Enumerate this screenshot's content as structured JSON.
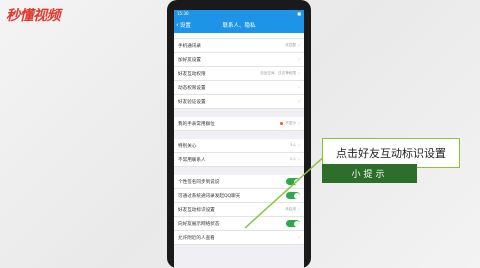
{
  "watermark": "秒懂视频",
  "status": {
    "time": "15:30",
    "battery": "■"
  },
  "header": {
    "back_label": "设置",
    "title": "联系人、隐私"
  },
  "rows": [
    {
      "label": "",
      "value": "",
      "type": "partial"
    },
    {
      "label": "手机通讯录",
      "value": "未匹配",
      "type": "value"
    },
    {
      "label": "加好友设置",
      "value": "",
      "type": "arrow"
    },
    {
      "label": "好友互动权限",
      "value": "包含空间、日志等权限",
      "type": "value"
    },
    {
      "label": "动态权限设置",
      "value": "",
      "type": "arrow"
    },
    {
      "label": "好友验证设置",
      "value": "",
      "type": "arrow"
    },
    {
      "label": "",
      "value": "",
      "type": "gap"
    },
    {
      "label": "我的手表常用群位",
      "value": "不显示",
      "type": "dot"
    },
    {
      "label": "",
      "value": "",
      "type": "gap"
    },
    {
      "label": "特别关心",
      "value": "5人",
      "type": "value"
    },
    {
      "label": "不常用联系人",
      "value": "0人",
      "type": "value"
    },
    {
      "label": "",
      "value": "",
      "type": "gap"
    },
    {
      "label": "个性签名同步到说说",
      "value": "",
      "type": "toggle"
    },
    {
      "label": "可通过系统通讯录发起QQ聊天",
      "value": "",
      "type": "toggle"
    },
    {
      "label": "好友互动标识设置",
      "value": "未启用",
      "type": "value"
    },
    {
      "label": "向好友展示网络状态",
      "value": "",
      "type": "toggle"
    },
    {
      "label": "允许附近的人查看",
      "value": "",
      "type": "arrow"
    }
  ],
  "callout": {
    "text": "点击好友互动标识设置",
    "tip": "小提示"
  },
  "colors": {
    "header": "#1e94e8",
    "toggle": "#2ea94a",
    "callout_border": "#8fbf3a",
    "tip_bg": "#2c6e2a"
  }
}
